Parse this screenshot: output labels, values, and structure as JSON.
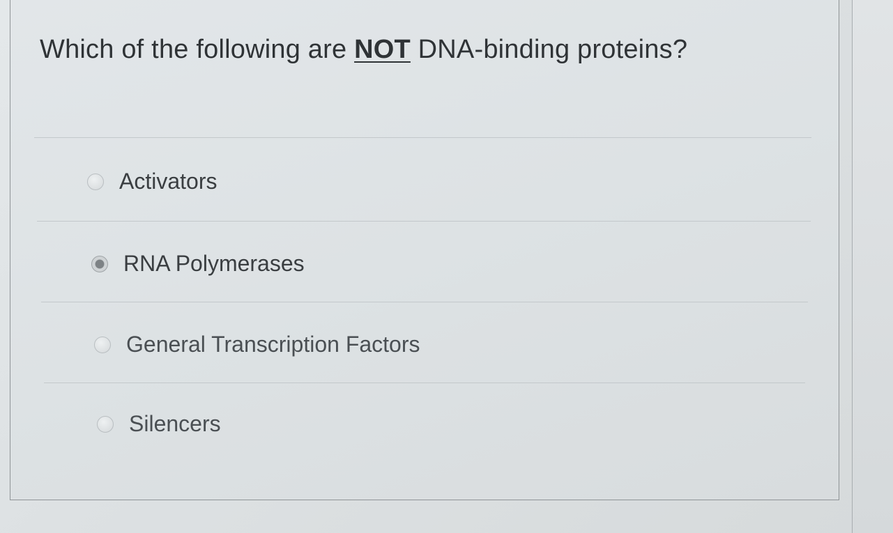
{
  "question": {
    "prefix": "Which of the following are ",
    "emphasis": "NOT",
    "suffix": " DNA-binding proteins?"
  },
  "options": [
    {
      "label": "Activators",
      "selected": false
    },
    {
      "label": "RNA Polymerases",
      "selected": true
    },
    {
      "label": "General Transcription Factors",
      "selected": false
    },
    {
      "label": "Silencers",
      "selected": false
    }
  ],
  "colors": {
    "text": "#2f3336",
    "radio_selected": "#7d8285",
    "divider": "#c3c8cb"
  }
}
